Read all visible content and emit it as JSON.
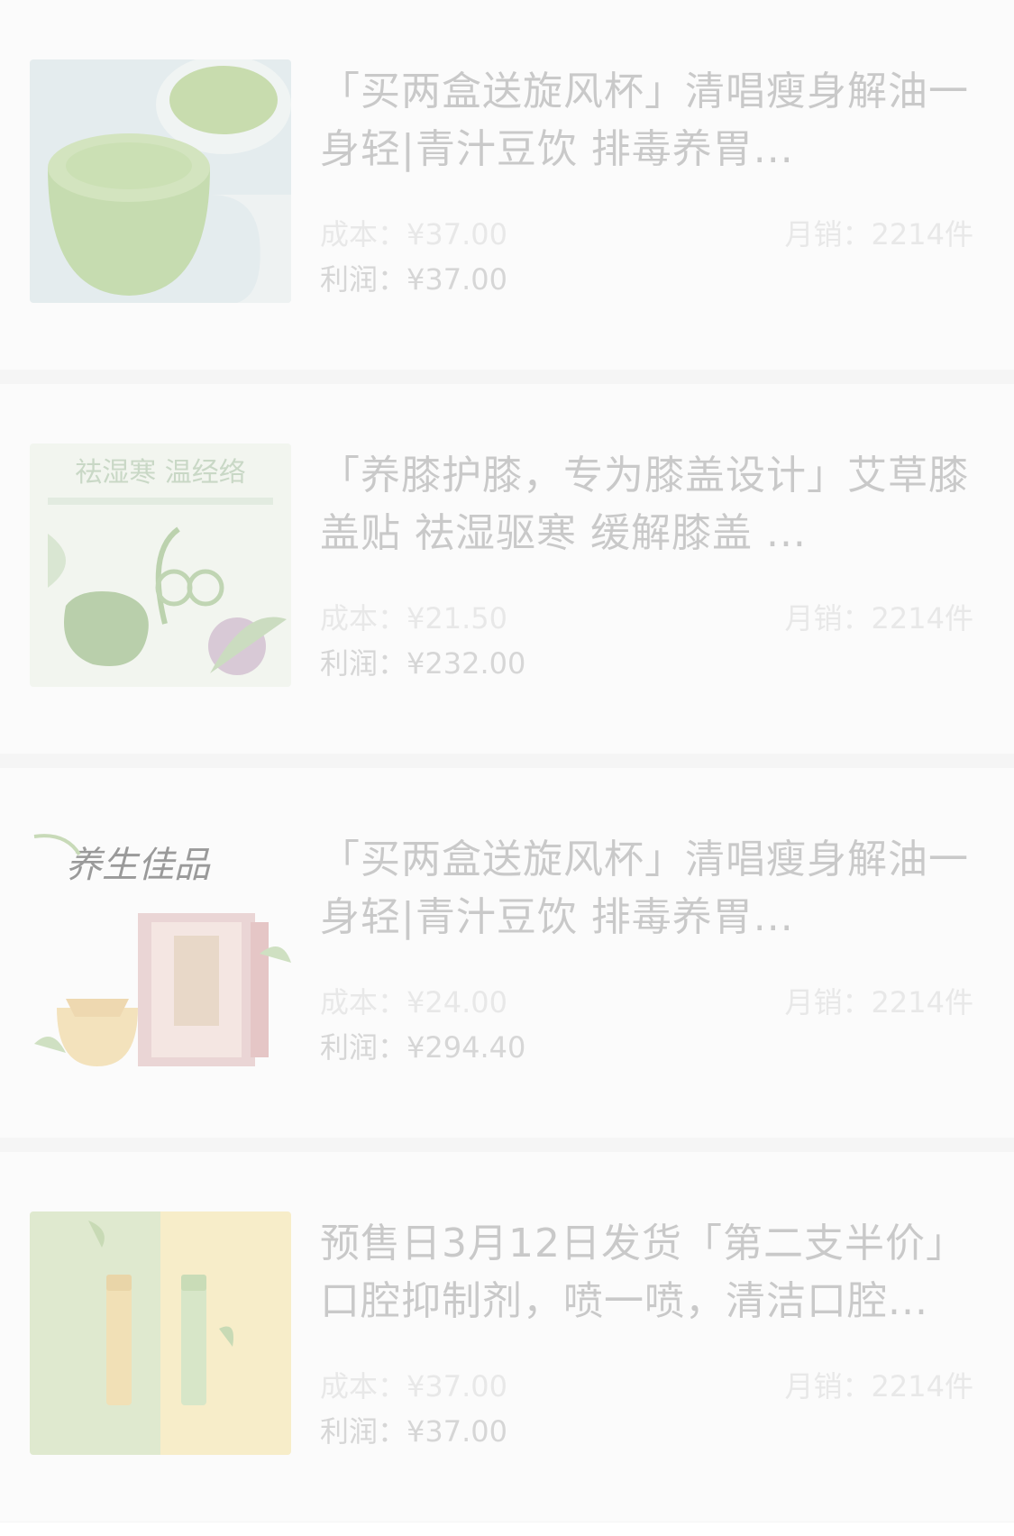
{
  "products": [
    {
      "title": "「买两盒送旋风杯」清唱瘦身解油一身轻|青汁豆饮 排毒养胃...",
      "cost_label": "成本：",
      "cost": "¥37.00",
      "profit_label": "利润：",
      "profit": "¥37.00",
      "sales_label": "月销：",
      "sales": "2214件",
      "image": "green-drink-cups"
    },
    {
      "title": "「养膝护膝，专为膝盖设计」艾草膝盖贴 祛湿驱寒 缓解膝盖 ...",
      "cost_label": "成本：",
      "cost": "¥21.50",
      "profit_label": "利润：",
      "profit": "¥232.00",
      "sales_label": "月销：",
      "sales": "2214件",
      "image": "herbal-knee-patch",
      "image_text": "祛湿寒 温经络"
    },
    {
      "title": "「买两盒送旋风杯」清唱瘦身解油一身轻|青汁豆饮 排毒养胃...",
      "cost_label": "成本：",
      "cost": "¥24.00",
      "profit_label": "利润：",
      "profit": "¥294.40",
      "sales_label": "月销：",
      "sales": "2214件",
      "image": "health-tea-box",
      "image_text": "养生佳品"
    },
    {
      "title": "预售日3月12日发货「第二支半价」口腔抑制剂，喷一喷，清洁口腔...",
      "cost_label": "成本：",
      "cost": "¥37.00",
      "profit_label": "利润：",
      "profit": "¥37.00",
      "sales_label": "月销：",
      "sales": "2214件",
      "image": "oral-spray-bottles"
    }
  ]
}
